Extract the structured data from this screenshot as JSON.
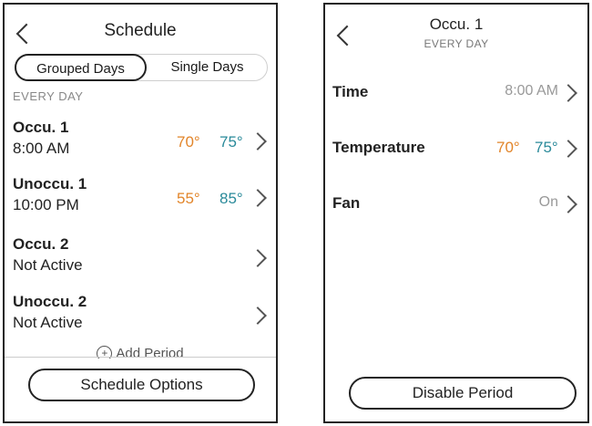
{
  "schedule": {
    "title": "Schedule",
    "tabs": {
      "grouped": "Grouped Days",
      "single": "Single Days"
    },
    "section": "EVERY DAY",
    "periods": [
      {
        "name": "Occu. 1",
        "sub": "8:00 AM",
        "heat": "70°",
        "cool": "75°"
      },
      {
        "name": "Unoccu. 1",
        "sub": "10:00 PM",
        "heat": "55°",
        "cool": "85°"
      },
      {
        "name": "Occu. 2",
        "sub": "Not Active",
        "heat": "",
        "cool": ""
      },
      {
        "name": "Unoccu. 2",
        "sub": "Not Active",
        "heat": "",
        "cool": ""
      }
    ],
    "add_period": "Add Period",
    "options_button": "Schedule Options"
  },
  "detail": {
    "title": "Occu. 1",
    "subtitle": "EVERY DAY",
    "time": {
      "label": "Time",
      "value": "8:00 AM"
    },
    "temp": {
      "label": "Temperature",
      "heat": "70°",
      "cool": "75°"
    },
    "fan": {
      "label": "Fan",
      "value": "On"
    },
    "disable_button": "Disable Period"
  },
  "colors": {
    "heat": "#e2852a",
    "cool": "#2a8a9a"
  },
  "icons": {
    "back": "chevron-left-icon",
    "forward": "chevron-right-icon",
    "add": "plus-circle-icon"
  }
}
